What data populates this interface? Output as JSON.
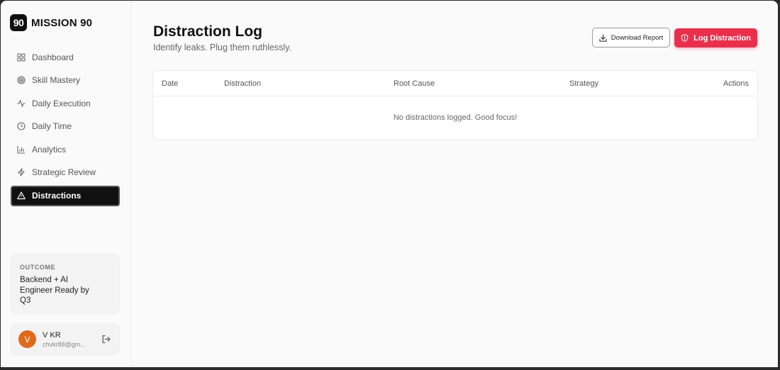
{
  "brand": {
    "logo": "90",
    "name": "MISSION 90"
  },
  "sidebar": {
    "items": [
      {
        "label": "Dashboard",
        "icon": "grid-icon"
      },
      {
        "label": "Skill Mastery",
        "icon": "target-icon"
      },
      {
        "label": "Daily Execution",
        "icon": "activity-icon"
      },
      {
        "label": "Daily Time",
        "icon": "clock-icon"
      },
      {
        "label": "Analytics",
        "icon": "bar-chart-icon"
      },
      {
        "label": "Strategic Review",
        "icon": "lightning-icon"
      },
      {
        "label": "Distractions",
        "icon": "warning-icon",
        "active": true
      }
    ],
    "outcome": {
      "label": "OUTCOME",
      "text": "Backend + AI Engineer Ready by Q3"
    },
    "user": {
      "initial": "V",
      "name": "V KR",
      "email": "chvkr88@gm..."
    }
  },
  "main": {
    "title": "Distraction Log",
    "subtitle": "Identify leaks. Plug them ruthlessly.",
    "download_label": "Download Report",
    "log_label": "Log Distraction",
    "table": {
      "columns": [
        "Date",
        "Distraction",
        "Root Cause",
        "Strategy",
        "Actions"
      ],
      "empty_message": "No distractions logged. Good focus!"
    }
  },
  "colors": {
    "accent": "#e8304d",
    "active_nav": "#111111",
    "avatar": "#e06a1c"
  }
}
